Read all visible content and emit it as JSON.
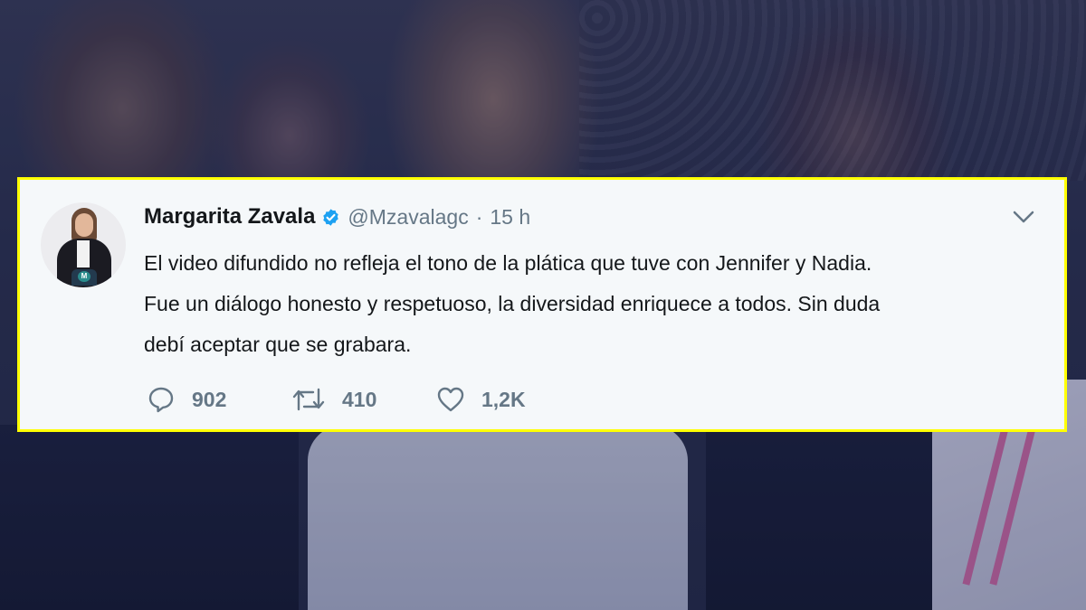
{
  "tweet": {
    "author": {
      "display_name": "Margarita Zavala",
      "handle": "@Mzavalagc",
      "verified": true,
      "avatar_monogram": "M"
    },
    "separator": "·",
    "timestamp": "15 h",
    "text_lines": [
      "El video difundido no refleja el tono de la plática que tuve con Jennifer y Nadia.",
      "Fue un diálogo honesto y respetuoso, la diversidad enriquece a todos. Sin duda",
      "debí aceptar que se grabara."
    ],
    "actions": {
      "reply": {
        "icon": "reply-icon",
        "count": "902"
      },
      "retweet": {
        "icon": "retweet-icon",
        "count": "410"
      },
      "like": {
        "icon": "heart-icon",
        "count": "1,2K"
      }
    },
    "menu_icon": "chevron-down-icon"
  },
  "colors": {
    "card_border": "#ffff00",
    "card_background": "#f5f8fa",
    "verified_blue": "#1da1f2",
    "secondary_text": "#657786",
    "primary_text": "#14171a"
  }
}
